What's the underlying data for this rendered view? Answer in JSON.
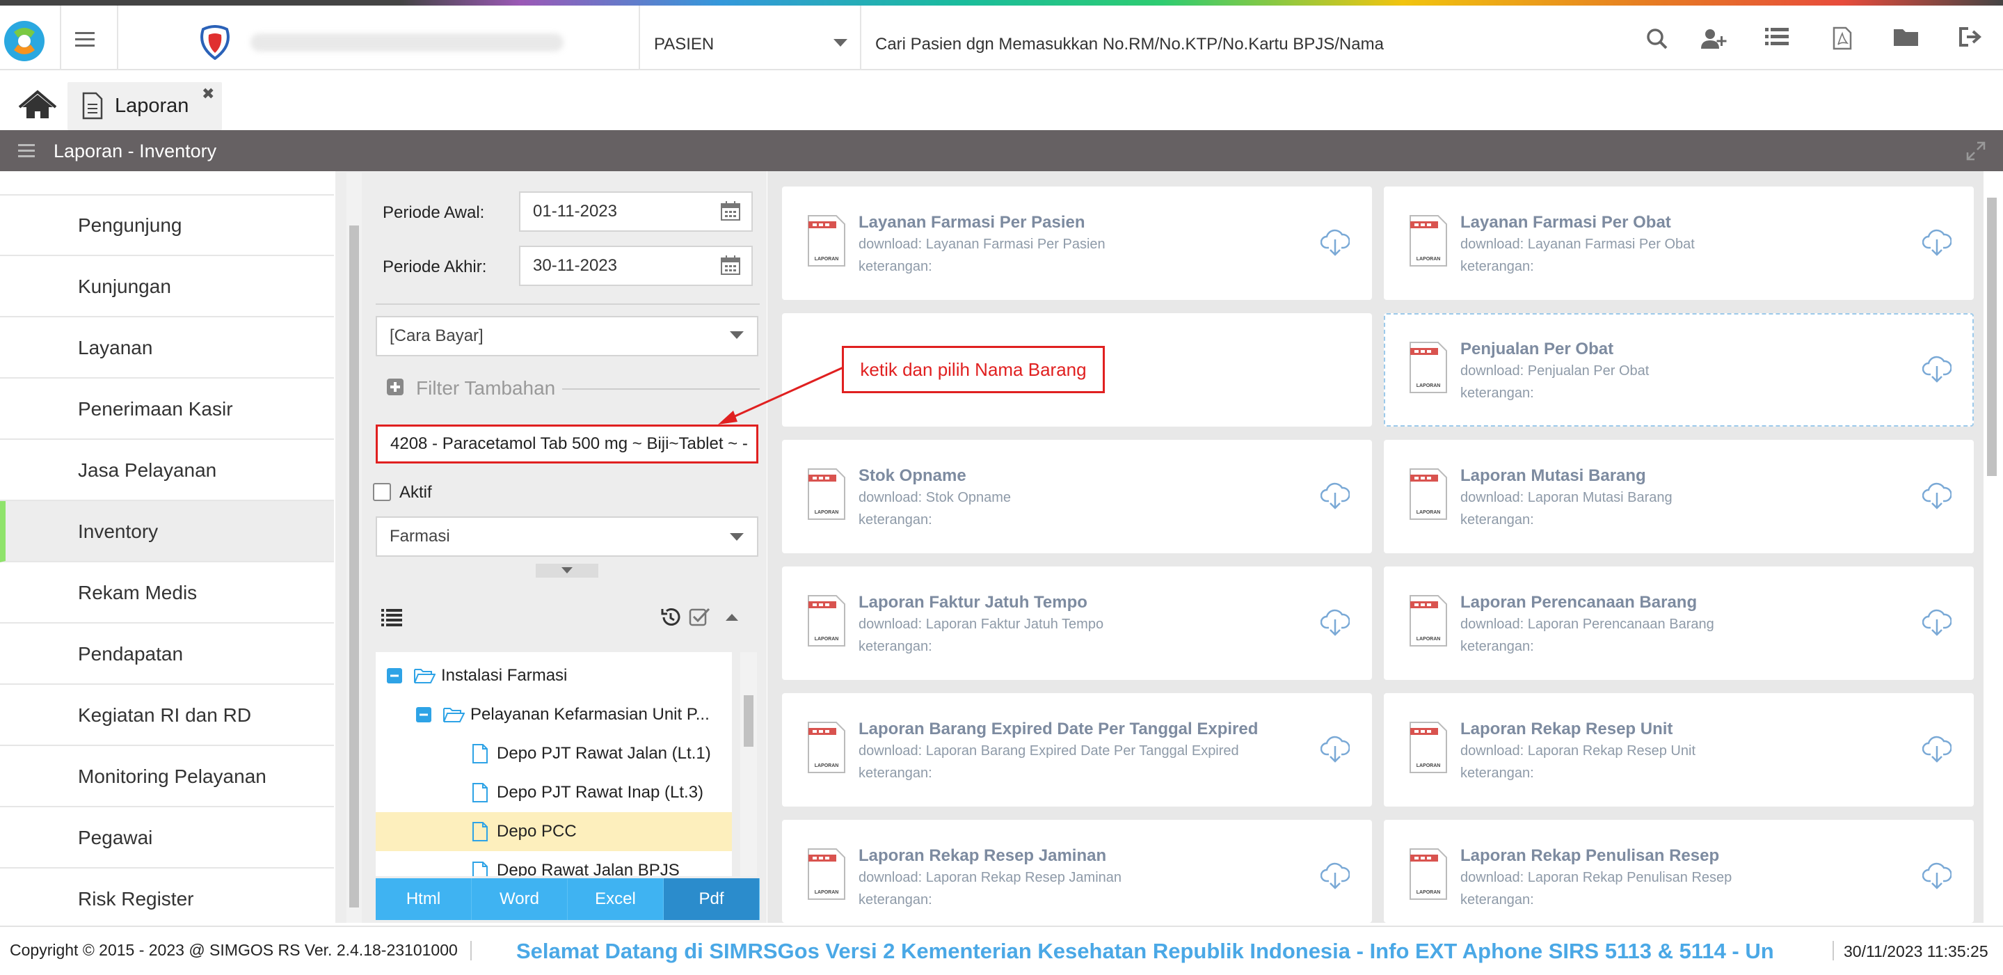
{
  "header": {
    "module": "PASIEN",
    "search_placeholder": "Cari Pasien dgn Memasukkan No.RM/No.KTP/No.Kartu BPJS/Nama"
  },
  "tab": {
    "label": "Laporan"
  },
  "section": {
    "title": "Laporan - Inventory"
  },
  "nav": {
    "items": [
      "Pengunjung",
      "Kunjungan",
      "Layanan",
      "Penerimaan Kasir",
      "Jasa Pelayanan",
      "Inventory",
      "Rekam Medis",
      "Pendapatan",
      "Kegiatan RI dan RD",
      "Monitoring Pelayanan",
      "Pegawai",
      "Risk Register"
    ],
    "active": "Inventory"
  },
  "filter": {
    "periode_awal_label": "Periode Awal:",
    "periode_awal_value": "01-11-2023",
    "periode_akhir_label": "Periode Akhir:",
    "periode_akhir_value": "30-11-2023",
    "cara_bayar": "[Cara Bayar]",
    "filter_tambahan": "Filter Tambahan",
    "barang_value": "4208 - Paracetamol Tab 500 mg ~ Biji~Tablet ~ -",
    "aktif_label": "Aktif",
    "kategori": "Farmasi"
  },
  "annotation": "ketik dan pilih Nama Barang",
  "tree": {
    "items": [
      {
        "label": "Instalasi Farmasi",
        "level": 0,
        "type": "folder"
      },
      {
        "label": "Pelayanan Kefarmasian Unit P...",
        "level": 1,
        "type": "folder"
      },
      {
        "label": "Depo PJT Rawat Jalan (Lt.1)",
        "level": 2,
        "type": "file"
      },
      {
        "label": "Depo PJT Rawat Inap (Lt.3)",
        "level": 2,
        "type": "file"
      },
      {
        "label": "Depo PCC",
        "level": 2,
        "type": "file",
        "selected": true
      },
      {
        "label": "Depo Rawat Jalan BPJS",
        "level": 2,
        "type": "file"
      }
    ]
  },
  "export_buttons": [
    "Html",
    "Word",
    "Excel",
    "Pdf"
  ],
  "reports": [
    {
      "title": "Layanan Farmasi Per Pasien",
      "download": "download: Layanan Farmasi Per Pasien",
      "keterangan": "keterangan:"
    },
    {
      "title": "Layanan Farmasi Per Obat",
      "download": "download: Layanan Farmasi Per Obat",
      "keterangan": "keterangan:"
    },
    {
      "title": "",
      "download": "",
      "keterangan": ""
    },
    {
      "title": "Penjualan Per Obat",
      "download": "download: Penjualan Per Obat",
      "keterangan": "keterangan:"
    },
    {
      "title": "Stok Opname",
      "download": "download: Stok Opname",
      "keterangan": "keterangan:"
    },
    {
      "title": "Laporan Mutasi Barang",
      "download": "download: Laporan Mutasi Barang",
      "keterangan": "keterangan:"
    },
    {
      "title": "Laporan Faktur Jatuh Tempo",
      "download": "download: Laporan Faktur Jatuh Tempo",
      "keterangan": "keterangan:"
    },
    {
      "title": "Laporan Perencanaan Barang",
      "download": "download: Laporan Perencanaan Barang",
      "keterangan": "keterangan:"
    },
    {
      "title": "Laporan Barang Expired Date Per Tanggal Expired",
      "download": "download: Laporan Barang Expired Date Per Tanggal Expired",
      "keterangan": "keterangan:"
    },
    {
      "title": "Laporan Rekap Resep Unit",
      "download": "download: Laporan Rekap Resep Unit",
      "keterangan": "keterangan:"
    },
    {
      "title": "Laporan Rekap Resep Jaminan",
      "download": "download: Laporan Rekap Resep Jaminan",
      "keterangan": "keterangan:"
    },
    {
      "title": "Laporan Rekap Penulisan Resep",
      "download": "download: Laporan Rekap Penulisan Resep",
      "keterangan": "keterangan:"
    }
  ],
  "doc_icon_label": "LAPORAN",
  "footer": {
    "copyright": "Copyright © 2015 - 2023 @ SIMGOS RS Ver. 2.4.18-23101000",
    "marquee": "Selamat Datang di SIMRSGos Versi 2 Kementerian Kesehatan Republik Indonesia - Info EXT Aphone SIRS 5113 & 5114 - Un",
    "datetime": "30/11/2023 11:35:25"
  },
  "colors": {
    "accent": "#3fb3f2",
    "active_nav": "#8fe36b",
    "annotation": "#e02020",
    "header_bar": "#666163"
  }
}
